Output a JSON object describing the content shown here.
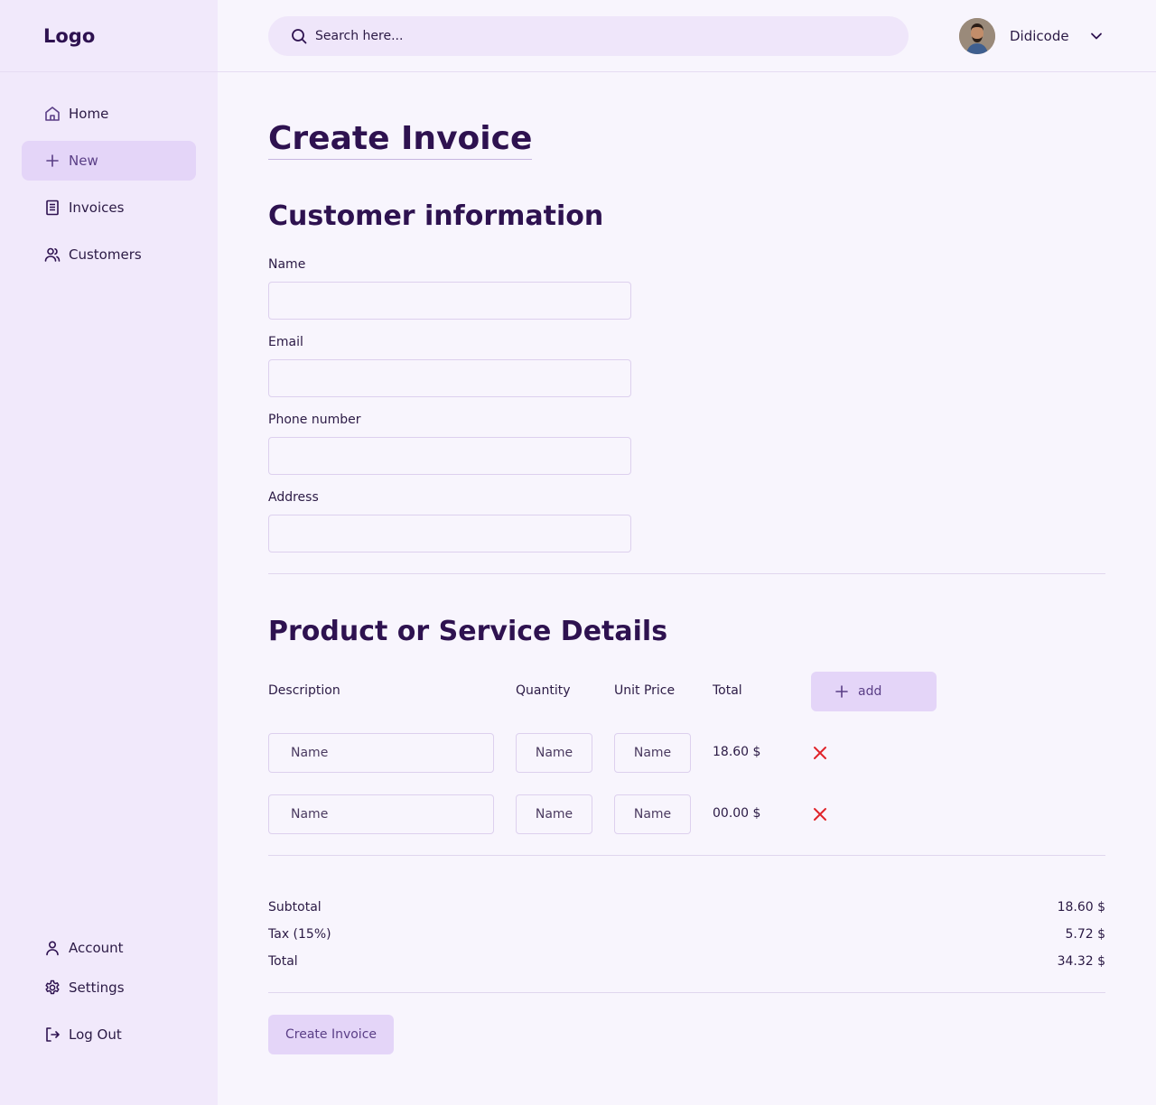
{
  "brand": {
    "logo": "Logo"
  },
  "sidebar": {
    "items": [
      {
        "label": "Home",
        "icon": "home-icon"
      },
      {
        "label": "New",
        "icon": "plus-icon"
      },
      {
        "label": "Invoices",
        "icon": "document-icon"
      },
      {
        "label": "Customers",
        "icon": "users-icon"
      }
    ],
    "bottom": [
      {
        "label": "Account",
        "icon": "user-icon"
      },
      {
        "label": "Settings",
        "icon": "gear-icon"
      },
      {
        "label": "Log Out",
        "icon": "logout-icon"
      }
    ]
  },
  "header": {
    "search_placeholder": "Search here...",
    "user_name": "Didicode"
  },
  "page": {
    "title": "Create Invoice"
  },
  "customer": {
    "title": "Customer information",
    "fields": [
      {
        "label": "Name",
        "value": ""
      },
      {
        "label": "Email",
        "value": ""
      },
      {
        "label": "Phone number",
        "value": ""
      },
      {
        "label": "Address",
        "value": ""
      }
    ]
  },
  "products": {
    "title": "Product or Service Details",
    "columns": [
      "Description",
      "Quantity",
      "Unit Price",
      "Total"
    ],
    "add_label": "add",
    "rows": [
      {
        "description": "Name",
        "quantity": "Name",
        "unit_price": "Name",
        "total": "18.60 $"
      },
      {
        "description": "Name",
        "quantity": "Name",
        "unit_price": "Name",
        "total": "00.00 $"
      }
    ]
  },
  "summary": {
    "subtotal_label": "Subtotal",
    "subtotal": "18.60 $",
    "tax_label": "Tax (15%)",
    "tax": "5.72 $",
    "total_label": "Total",
    "total": "34.32 $"
  },
  "actions": {
    "create_label": "Create Invoice"
  },
  "colors": {
    "accent": "#e4d5f8",
    "sidebar_bg": "#f1e9fb",
    "heading": "#2e1250",
    "delete": "#e0242a"
  }
}
